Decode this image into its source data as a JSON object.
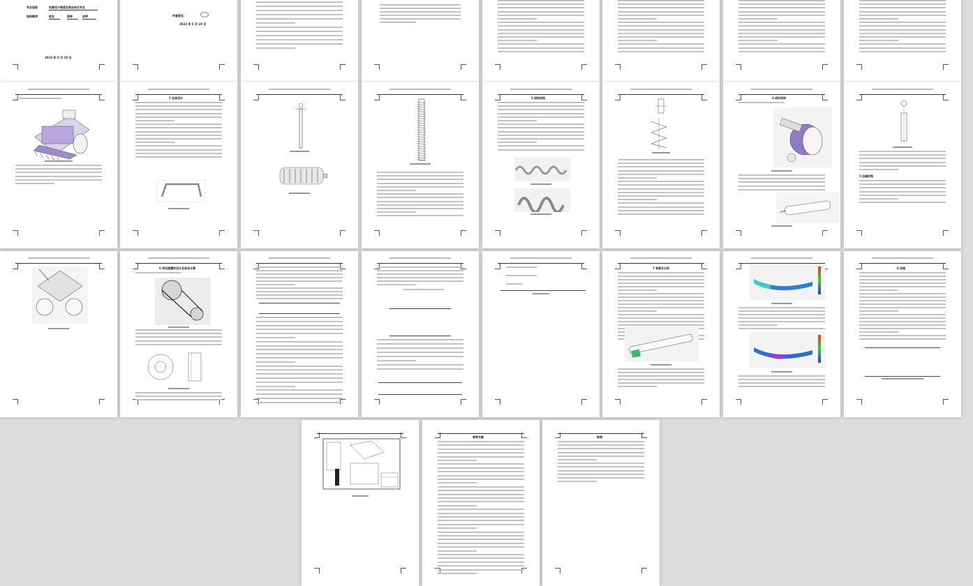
{
  "cover": {
    "row1_label": "专业班级",
    "row1_value": "机械设计制造及其自动化专业",
    "row2_label": "指导教师",
    "row2_value1": "姓名",
    "row2_value2": "职称",
    "row2_value3": "讲师",
    "date": "2023 年 5 月 10 日"
  },
  "page2": {
    "line1": "作者签名：",
    "line2": "2023 年 5 月 10 日"
  },
  "sections": {
    "s2": "2 总体设计",
    "s3": "3 进料机构",
    "s4": "4 成形机构",
    "s5": "5 压缩机构",
    "s6": "6 传动装置的设计及有关计算",
    "s7": "7 有限元分析",
    "s8": "8 总结",
    "refs": "参考文献",
    "thanks": "致谢"
  },
  "theme": {
    "background": "#dcdcdc",
    "page": "#ffffff",
    "accent_purple": "#7b63b5"
  }
}
